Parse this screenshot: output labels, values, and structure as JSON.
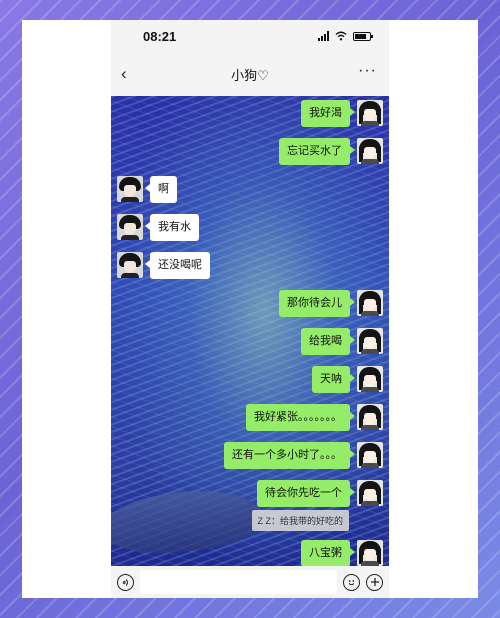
{
  "status": {
    "time": "08:21"
  },
  "nav": {
    "back_icon": "chevron-left-icon",
    "title": "小狗♡",
    "more_icon": "more-dots-icon"
  },
  "messages": [
    {
      "side": "right",
      "text": "我好渴"
    },
    {
      "side": "right",
      "text": "忘记买水了"
    },
    {
      "side": "left",
      "text": "啊"
    },
    {
      "side": "left",
      "text": "我有水"
    },
    {
      "side": "left",
      "text": "还没喝呢"
    },
    {
      "side": "right",
      "text": "那你待会儿"
    },
    {
      "side": "right",
      "text": "给我喝"
    },
    {
      "side": "right",
      "text": "天呐"
    },
    {
      "side": "right",
      "text": "我好紧张。。。。。。。"
    },
    {
      "side": "right",
      "text": "还有一个多小时了。。。"
    },
    {
      "side": "right",
      "text": "待会你先吃一个"
    },
    {
      "side": "right",
      "text": "八宝粥"
    }
  ],
  "quote": {
    "text": "Z Z：给我带的好吃的"
  },
  "input": {
    "value": "",
    "placeholder": ""
  },
  "colors": {
    "my_bubble": "#95ec69",
    "their_bubble": "#ffffff",
    "bar": "#f4f4f4"
  }
}
